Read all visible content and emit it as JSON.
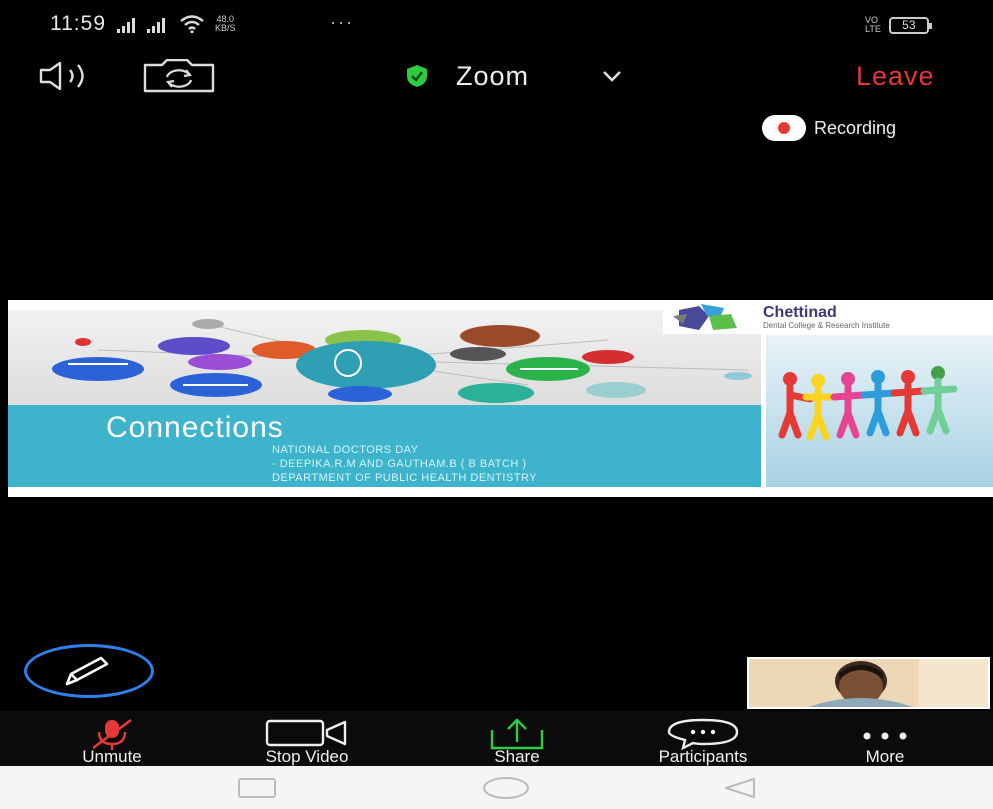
{
  "status_bar": {
    "time": "11:59",
    "speed_value": "48.0",
    "speed_unit": "KB/S",
    "more": "···",
    "network_top": "VO",
    "network_bottom": "LTE",
    "battery": "53"
  },
  "top_bar": {
    "title": "Zoom",
    "leave_label": "Leave"
  },
  "recording": {
    "label": "Recording"
  },
  "shared_slide": {
    "heading": "Connections",
    "lines": [
      "NATIONAL DOCTORS DAY",
      "- DEEPIKA.R.M AND GAUTHAM.B ( B BATCH )",
      "DEPARTMENT OF PUBLIC HEALTH DENTISTRY"
    ],
    "logo_name": "Chettinad",
    "logo_subtitle": "Dental College & Research Institute"
  },
  "toolbar": {
    "items": [
      {
        "label": "Unmute",
        "icon": "muted-mic-icon"
      },
      {
        "label": "Stop Video",
        "icon": "video-camera-icon"
      },
      {
        "label": "Share",
        "icon": "share-icon"
      },
      {
        "label": "Participants",
        "icon": "chat-bubble-icon"
      },
      {
        "label": "More",
        "icon": "more-dots-icon"
      }
    ]
  },
  "colors": {
    "leave": "#e53935",
    "share_green": "#2ecc40",
    "recording_dot": "#e53935",
    "annotate_ring": "#2f80ed",
    "slide_band": "#3db4cb"
  }
}
